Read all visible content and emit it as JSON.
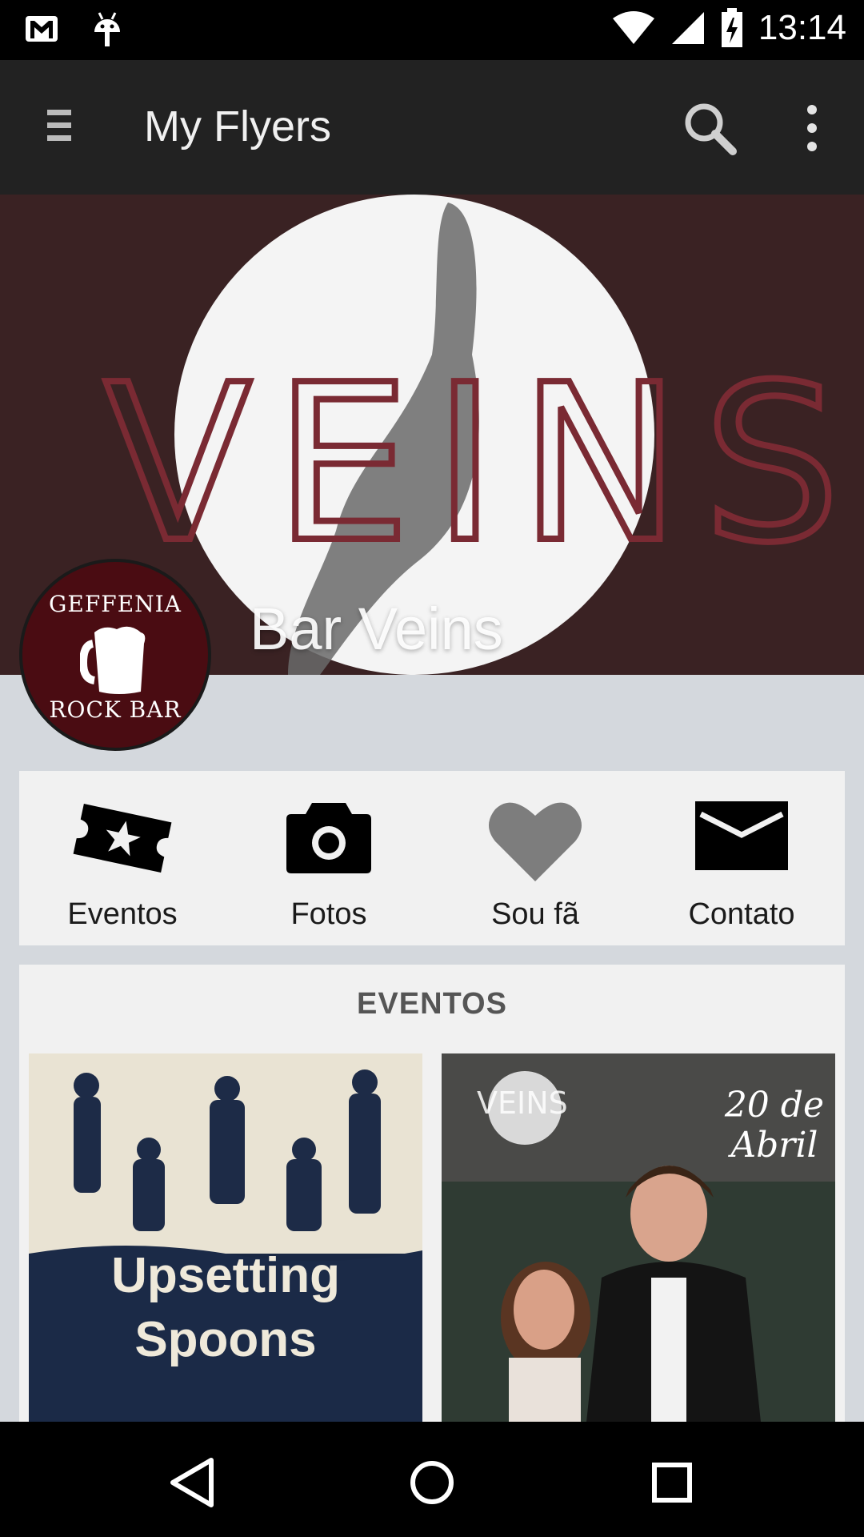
{
  "status_bar": {
    "time": "13:14",
    "icons": [
      "gmail-icon",
      "android-icon",
      "wifi-icon",
      "signal-icon",
      "battery-icon"
    ]
  },
  "app_bar": {
    "title": "My Flyers",
    "icons": [
      "menu-icon",
      "search-icon",
      "more-vert-icon"
    ]
  },
  "cover": {
    "logo_text": "VEINS",
    "venue_name": "Bar Veins"
  },
  "avatar": {
    "line1": "GEFFENIA",
    "line2": "ROCK BAR"
  },
  "actions": [
    {
      "label": "Eventos",
      "icon": "ticket-star-icon"
    },
    {
      "label": "Fotos",
      "icon": "camera-icon"
    },
    {
      "label": "Sou fã",
      "icon": "heart-icon"
    },
    {
      "label": "Contato",
      "icon": "envelope-icon"
    }
  ],
  "events": {
    "title": "EVENTOS",
    "flyers": [
      {
        "line1": "Upsetting",
        "line2": "Spoons"
      },
      {
        "badge": "VEINS",
        "date_line1": "20 de",
        "date_line2": "Abril"
      }
    ]
  },
  "colors": {
    "app_bar": "#222222",
    "cover_bg": "#3a2223",
    "page_bg": "#d4d8dd",
    "card_bg": "#f1f1f1",
    "logo_red": "#7a2a33",
    "avatar_bg": "#4a0c12"
  }
}
